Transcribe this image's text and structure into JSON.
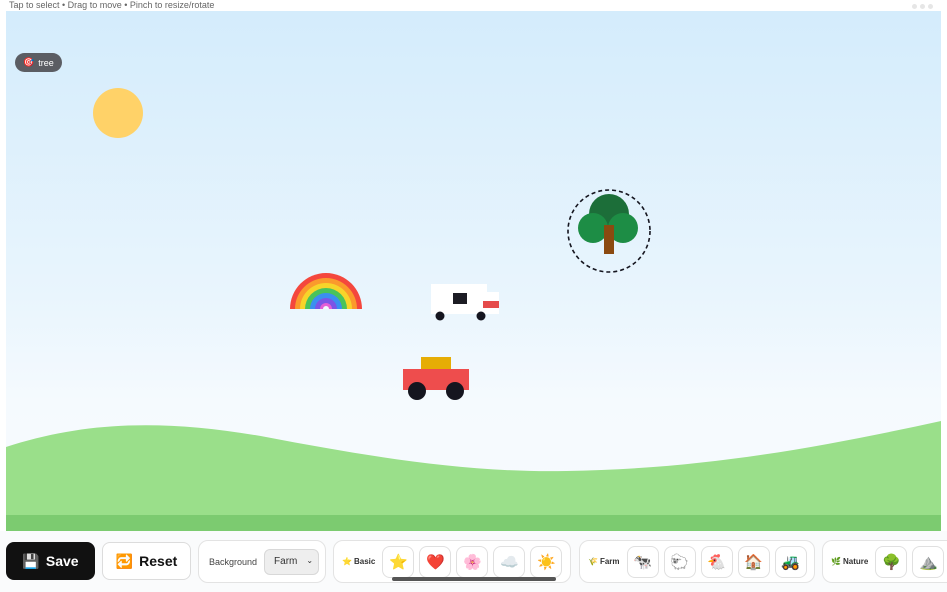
{
  "hint": "Tap to select • Drag to move • Pinch to resize/rotate",
  "selected_tag": {
    "icon": "🎯",
    "label": "tree"
  },
  "toolbar": {
    "save_icon": "💾",
    "save_label": "Save",
    "reset_icon": "🔁",
    "reset_label": "Reset",
    "background_label": "Background",
    "background_value": "Farm",
    "palettes": {
      "basic": {
        "icon": "⭐",
        "label": "Basic",
        "items": [
          "⭐",
          "❤️",
          "🌸",
          "☁️",
          "☀️"
        ]
      },
      "farm": {
        "icon": "🌾",
        "label": "Farm",
        "items": [
          "🐄",
          "🐑",
          "🐔",
          "🏠",
          "🚜"
        ]
      },
      "nature": {
        "icon": "🌿",
        "label": "Nature",
        "items": [
          "🌳",
          "⛰️"
        ]
      }
    }
  },
  "colors": {
    "sun": "#ffd268",
    "grass": "#9adf8a",
    "grass_dark": "#7ccb70",
    "tree_dark": "#1c6e39",
    "tree_light": "#1d8d45",
    "trunk": "#8b4a10",
    "truck_red": "#ee4d4d",
    "truck_cargo": "#e6ad05",
    "save_bg": "#111111"
  }
}
